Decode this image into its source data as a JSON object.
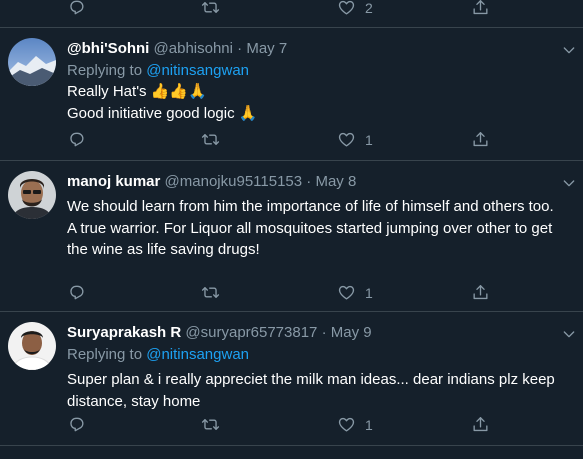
{
  "top_actions": {
    "like_count": "2"
  },
  "tweets": [
    {
      "name": "@bhi'Sohni",
      "handle": "@abhisohni",
      "date": "May 7",
      "replying_prefix": "Replying to",
      "replying_to": "@nitinsangwan",
      "lines": [
        "Really Hat's 👍👍🙏",
        "Good initiative good logic 🙏"
      ],
      "like_count": "1"
    },
    {
      "name": "manoj kumar",
      "handle": "@manojku95115153",
      "date": "May 8",
      "lines": [
        "We should learn from him the importance of life of himself and others too.",
        "A true warrior. For Liquor all mosquitoes started jumping over other to get",
        "the wine as life saving drugs!"
      ],
      "like_count": "1"
    },
    {
      "name": "Suryaprakash R",
      "handle": "@suryapr65773817",
      "date": "May 9",
      "replying_prefix": "Replying to",
      "replying_to": "@nitinsangwan",
      "lines": [
        "Super plan & i really appreciet the milk man ideas... dear indians plz keep",
        "distance, stay home"
      ],
      "like_count": "1"
    }
  ],
  "separator": "·",
  "colors": {
    "background": "#15202b",
    "divider": "#38444d",
    "muted_text": "#8899a6",
    "link": "#1da1f2"
  },
  "icons": [
    "reply-icon",
    "retweet-icon",
    "like-icon",
    "share-icon",
    "caret-down-icon"
  ]
}
